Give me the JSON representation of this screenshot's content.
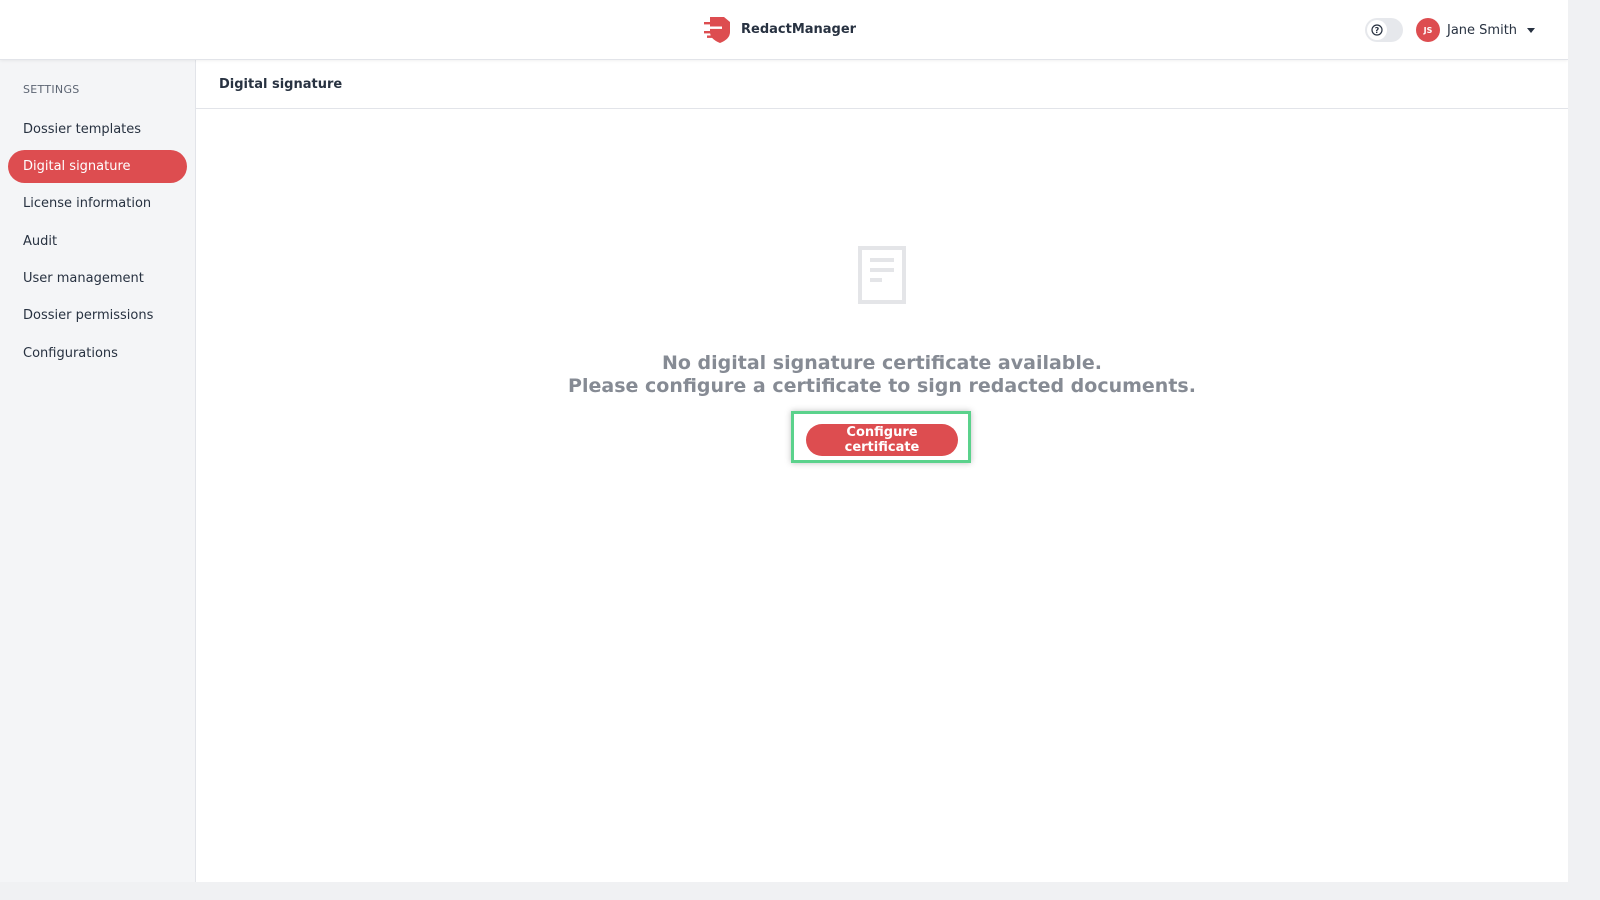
{
  "header": {
    "app_name": "RedactManager",
    "help_toggle_icon": "help-circle-icon",
    "user": {
      "initials": "JS",
      "name": "Jane Smith",
      "menu_icon": "chevron-down-icon"
    }
  },
  "sidebar": {
    "title": "SETTINGS",
    "items": [
      {
        "label": "Dossier templates",
        "active": false
      },
      {
        "label": "Digital signature",
        "active": true
      },
      {
        "label": "License information",
        "active": false
      },
      {
        "label": "Audit",
        "active": false
      },
      {
        "label": "User management",
        "active": false
      },
      {
        "label": "Dossier permissions",
        "active": false
      },
      {
        "label": "Configurations",
        "active": false
      }
    ]
  },
  "main": {
    "title": "Digital signature",
    "empty_state": {
      "icon": "document-icon",
      "line1": "No digital signature certificate available.",
      "line2": "Please configure a certificate to sign redacted documents.",
      "button_label": "Configure certificate"
    }
  },
  "colors": {
    "accent": "#dd4d50",
    "highlight": "#5bd28c",
    "muted_text": "#868b94"
  }
}
